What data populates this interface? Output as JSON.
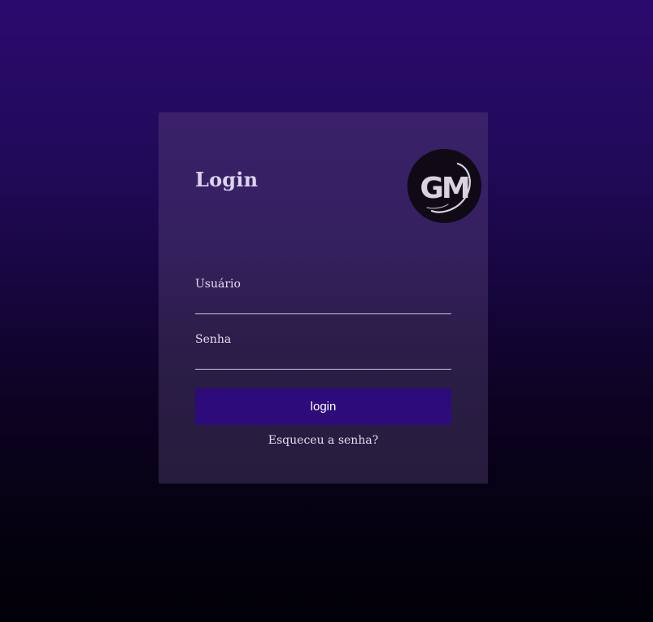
{
  "login_card": {
    "title": "Login",
    "logo": {
      "icon": "gm-logo",
      "text": "GM",
      "background_color": "#0f0a16",
      "text_color": "#d9d3e0"
    },
    "fields": {
      "username": {
        "label": "Usuário",
        "value": "",
        "placeholder": ""
      },
      "password": {
        "label": "Senha",
        "value": "",
        "placeholder": ""
      }
    },
    "login_button_label": "login",
    "forgot_password_link": "Esqueceu a senha?"
  },
  "colors": {
    "button": "#2e0b7a",
    "background_top": "#2a0b6e",
    "background_bottom": "#020008",
    "card": "#35205f"
  }
}
